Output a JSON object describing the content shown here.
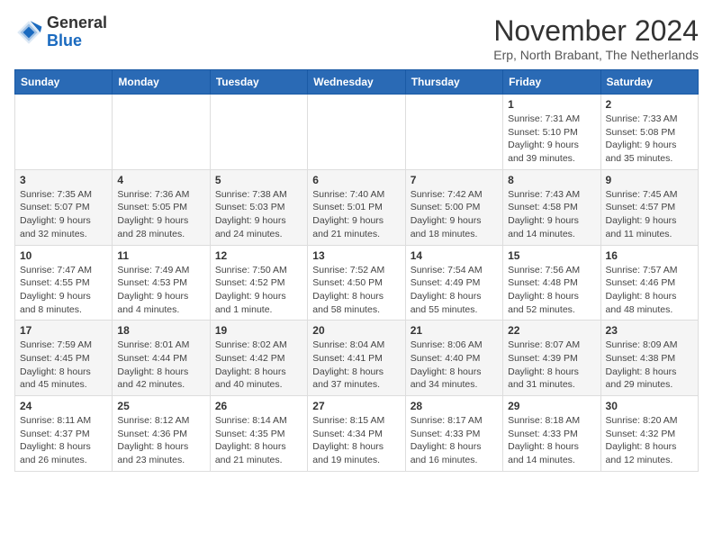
{
  "header": {
    "logo_general": "General",
    "logo_blue": "Blue",
    "month_title": "November 2024",
    "subtitle": "Erp, North Brabant, The Netherlands"
  },
  "days_of_week": [
    "Sunday",
    "Monday",
    "Tuesday",
    "Wednesday",
    "Thursday",
    "Friday",
    "Saturday"
  ],
  "weeks": [
    [
      {
        "day": "",
        "info": ""
      },
      {
        "day": "",
        "info": ""
      },
      {
        "day": "",
        "info": ""
      },
      {
        "day": "",
        "info": ""
      },
      {
        "day": "",
        "info": ""
      },
      {
        "day": "1",
        "info": "Sunrise: 7:31 AM\nSunset: 5:10 PM\nDaylight: 9 hours and 39 minutes."
      },
      {
        "day": "2",
        "info": "Sunrise: 7:33 AM\nSunset: 5:08 PM\nDaylight: 9 hours and 35 minutes."
      }
    ],
    [
      {
        "day": "3",
        "info": "Sunrise: 7:35 AM\nSunset: 5:07 PM\nDaylight: 9 hours and 32 minutes."
      },
      {
        "day": "4",
        "info": "Sunrise: 7:36 AM\nSunset: 5:05 PM\nDaylight: 9 hours and 28 minutes."
      },
      {
        "day": "5",
        "info": "Sunrise: 7:38 AM\nSunset: 5:03 PM\nDaylight: 9 hours and 24 minutes."
      },
      {
        "day": "6",
        "info": "Sunrise: 7:40 AM\nSunset: 5:01 PM\nDaylight: 9 hours and 21 minutes."
      },
      {
        "day": "7",
        "info": "Sunrise: 7:42 AM\nSunset: 5:00 PM\nDaylight: 9 hours and 18 minutes."
      },
      {
        "day": "8",
        "info": "Sunrise: 7:43 AM\nSunset: 4:58 PM\nDaylight: 9 hours and 14 minutes."
      },
      {
        "day": "9",
        "info": "Sunrise: 7:45 AM\nSunset: 4:57 PM\nDaylight: 9 hours and 11 minutes."
      }
    ],
    [
      {
        "day": "10",
        "info": "Sunrise: 7:47 AM\nSunset: 4:55 PM\nDaylight: 9 hours and 8 minutes."
      },
      {
        "day": "11",
        "info": "Sunrise: 7:49 AM\nSunset: 4:53 PM\nDaylight: 9 hours and 4 minutes."
      },
      {
        "day": "12",
        "info": "Sunrise: 7:50 AM\nSunset: 4:52 PM\nDaylight: 9 hours and 1 minute."
      },
      {
        "day": "13",
        "info": "Sunrise: 7:52 AM\nSunset: 4:50 PM\nDaylight: 8 hours and 58 minutes."
      },
      {
        "day": "14",
        "info": "Sunrise: 7:54 AM\nSunset: 4:49 PM\nDaylight: 8 hours and 55 minutes."
      },
      {
        "day": "15",
        "info": "Sunrise: 7:56 AM\nSunset: 4:48 PM\nDaylight: 8 hours and 52 minutes."
      },
      {
        "day": "16",
        "info": "Sunrise: 7:57 AM\nSunset: 4:46 PM\nDaylight: 8 hours and 48 minutes."
      }
    ],
    [
      {
        "day": "17",
        "info": "Sunrise: 7:59 AM\nSunset: 4:45 PM\nDaylight: 8 hours and 45 minutes."
      },
      {
        "day": "18",
        "info": "Sunrise: 8:01 AM\nSunset: 4:44 PM\nDaylight: 8 hours and 42 minutes."
      },
      {
        "day": "19",
        "info": "Sunrise: 8:02 AM\nSunset: 4:42 PM\nDaylight: 8 hours and 40 minutes."
      },
      {
        "day": "20",
        "info": "Sunrise: 8:04 AM\nSunset: 4:41 PM\nDaylight: 8 hours and 37 minutes."
      },
      {
        "day": "21",
        "info": "Sunrise: 8:06 AM\nSunset: 4:40 PM\nDaylight: 8 hours and 34 minutes."
      },
      {
        "day": "22",
        "info": "Sunrise: 8:07 AM\nSunset: 4:39 PM\nDaylight: 8 hours and 31 minutes."
      },
      {
        "day": "23",
        "info": "Sunrise: 8:09 AM\nSunset: 4:38 PM\nDaylight: 8 hours and 29 minutes."
      }
    ],
    [
      {
        "day": "24",
        "info": "Sunrise: 8:11 AM\nSunset: 4:37 PM\nDaylight: 8 hours and 26 minutes."
      },
      {
        "day": "25",
        "info": "Sunrise: 8:12 AM\nSunset: 4:36 PM\nDaylight: 8 hours and 23 minutes."
      },
      {
        "day": "26",
        "info": "Sunrise: 8:14 AM\nSunset: 4:35 PM\nDaylight: 8 hours and 21 minutes."
      },
      {
        "day": "27",
        "info": "Sunrise: 8:15 AM\nSunset: 4:34 PM\nDaylight: 8 hours and 19 minutes."
      },
      {
        "day": "28",
        "info": "Sunrise: 8:17 AM\nSunset: 4:33 PM\nDaylight: 8 hours and 16 minutes."
      },
      {
        "day": "29",
        "info": "Sunrise: 8:18 AM\nSunset: 4:33 PM\nDaylight: 8 hours and 14 minutes."
      },
      {
        "day": "30",
        "info": "Sunrise: 8:20 AM\nSunset: 4:32 PM\nDaylight: 8 hours and 12 minutes."
      }
    ]
  ]
}
